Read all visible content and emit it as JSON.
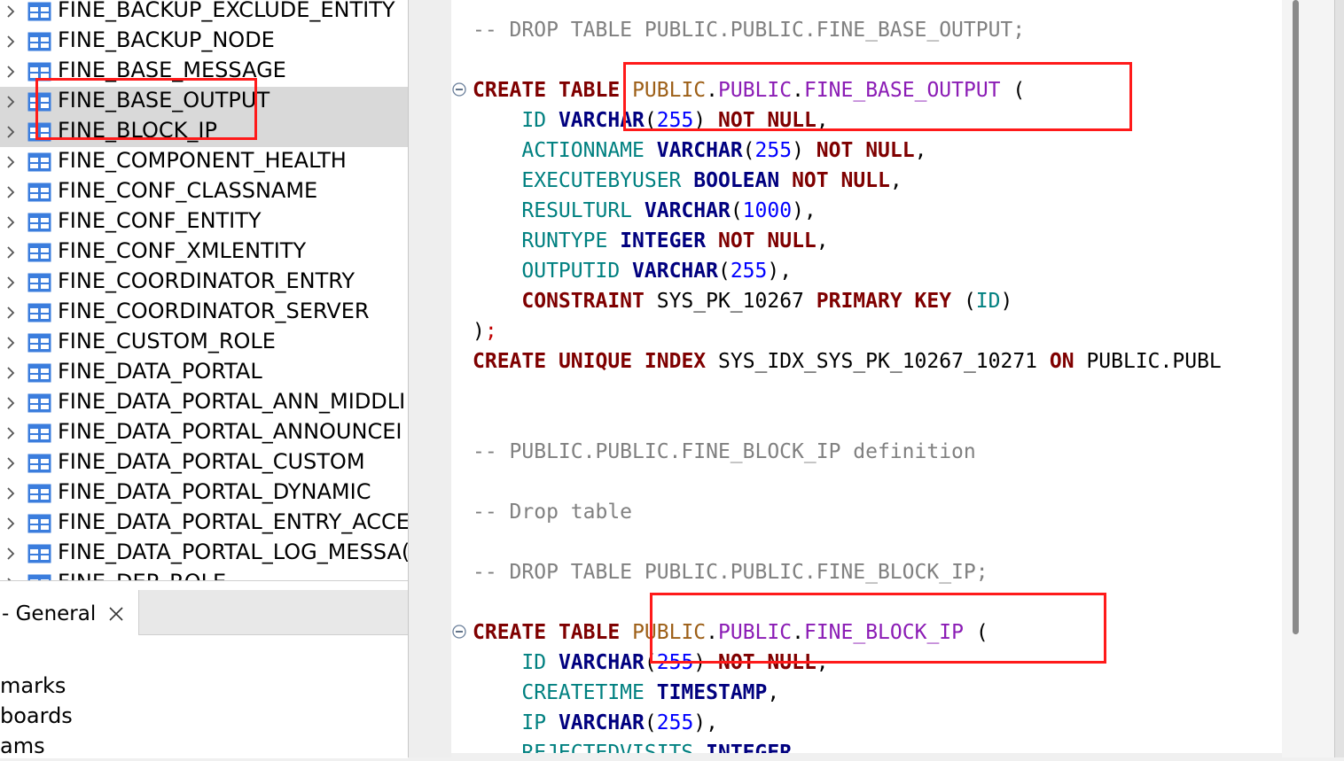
{
  "navigator": {
    "items": [
      {
        "label": "FINE_BACKUP_EXCLUDE_ENTITY",
        "selected": false
      },
      {
        "label": "FINE_BACKUP_NODE",
        "selected": false
      },
      {
        "label": "FINE_BASE_MESSAGE",
        "selected": false
      },
      {
        "label": "FINE_BASE_OUTPUT",
        "selected": true
      },
      {
        "label": "FINE_BLOCK_IP",
        "selected": true
      },
      {
        "label": "FINE_COMPONENT_HEALTH",
        "selected": false
      },
      {
        "label": "FINE_CONF_CLASSNAME",
        "selected": false
      },
      {
        "label": "FINE_CONF_ENTITY",
        "selected": false
      },
      {
        "label": "FINE_CONF_XMLENTITY",
        "selected": false
      },
      {
        "label": "FINE_COORDINATOR_ENTRY",
        "selected": false
      },
      {
        "label": "FINE_COORDINATOR_SERVER",
        "selected": false
      },
      {
        "label": "FINE_CUSTOM_ROLE",
        "selected": false
      },
      {
        "label": "FINE_DATA_PORTAL",
        "selected": false
      },
      {
        "label": "FINE_DATA_PORTAL_ANN_MIDDLI",
        "selected": false
      },
      {
        "label": "FINE_DATA_PORTAL_ANNOUNCEI",
        "selected": false
      },
      {
        "label": "FINE_DATA_PORTAL_CUSTOM",
        "selected": false
      },
      {
        "label": "FINE_DATA_PORTAL_DYNAMIC",
        "selected": false
      },
      {
        "label": "FINE_DATA_PORTAL_ENTRY_ACCE",
        "selected": false
      },
      {
        "label": "FINE_DATA_PORTAL_LOG_MESSA(",
        "selected": false
      },
      {
        "label": "FINE_DEP_ROLE",
        "selected": false
      }
    ],
    "item_icon": "table-icon",
    "expander_icon": "chevron-right-icon"
  },
  "bottom_panel": {
    "tab_label": "- General",
    "tab_close_icon": "close-icon",
    "items": [
      "marks",
      "boards",
      "ams"
    ]
  },
  "editor": {
    "lines": [
      {
        "tokens": [
          {
            "t": "-- DROP TABLE PUBLIC.PUBLIC.FINE_BASE_OUTPUT;",
            "c": "cm"
          }
        ]
      },
      {
        "tokens": []
      },
      {
        "fold": true,
        "tokens": [
          {
            "t": "CREATE",
            "c": "kw"
          },
          {
            "t": " ",
            "c": "pl"
          },
          {
            "t": "TABLE",
            "c": "kw"
          },
          {
            "t": " ",
            "c": "pl"
          },
          {
            "t": "PUBLIC",
            "c": "sch"
          },
          {
            "t": ".",
            "c": "punc"
          },
          {
            "t": "PUBLIC",
            "c": "tn"
          },
          {
            "t": ".",
            "c": "punc"
          },
          {
            "t": "FINE_BASE_OUTPUT",
            "c": "tn"
          },
          {
            "t": " (",
            "c": "punc"
          }
        ]
      },
      {
        "tokens": [
          {
            "t": "    ",
            "c": "pl"
          },
          {
            "t": "ID",
            "c": "col"
          },
          {
            "t": " ",
            "c": "pl"
          },
          {
            "t": "VARCHAR",
            "c": "ty"
          },
          {
            "t": "(",
            "c": "punc"
          },
          {
            "t": "255",
            "c": "num"
          },
          {
            "t": ") ",
            "c": "punc"
          },
          {
            "t": "NOT",
            "c": "kw"
          },
          {
            "t": " ",
            "c": "pl"
          },
          {
            "t": "NULL",
            "c": "kw"
          },
          {
            "t": ",",
            "c": "punc"
          }
        ]
      },
      {
        "tokens": [
          {
            "t": "    ",
            "c": "pl"
          },
          {
            "t": "ACTIONNAME",
            "c": "col"
          },
          {
            "t": " ",
            "c": "pl"
          },
          {
            "t": "VARCHAR",
            "c": "ty"
          },
          {
            "t": "(",
            "c": "punc"
          },
          {
            "t": "255",
            "c": "num"
          },
          {
            "t": ") ",
            "c": "punc"
          },
          {
            "t": "NOT",
            "c": "kw"
          },
          {
            "t": " ",
            "c": "pl"
          },
          {
            "t": "NULL",
            "c": "kw"
          },
          {
            "t": ",",
            "c": "punc"
          }
        ]
      },
      {
        "tokens": [
          {
            "t": "    ",
            "c": "pl"
          },
          {
            "t": "EXECUTEBYUSER",
            "c": "col"
          },
          {
            "t": " ",
            "c": "pl"
          },
          {
            "t": "BOOLEAN",
            "c": "ty"
          },
          {
            "t": " ",
            "c": "pl"
          },
          {
            "t": "NOT",
            "c": "kw"
          },
          {
            "t": " ",
            "c": "pl"
          },
          {
            "t": "NULL",
            "c": "kw"
          },
          {
            "t": ",",
            "c": "punc"
          }
        ]
      },
      {
        "tokens": [
          {
            "t": "    ",
            "c": "pl"
          },
          {
            "t": "RESULTURL",
            "c": "col"
          },
          {
            "t": " ",
            "c": "pl"
          },
          {
            "t": "VARCHAR",
            "c": "ty"
          },
          {
            "t": "(",
            "c": "punc"
          },
          {
            "t": "1000",
            "c": "num"
          },
          {
            "t": "),",
            "c": "punc"
          }
        ]
      },
      {
        "tokens": [
          {
            "t": "    ",
            "c": "pl"
          },
          {
            "t": "RUNTYPE",
            "c": "col"
          },
          {
            "t": " ",
            "c": "pl"
          },
          {
            "t": "INTEGER",
            "c": "ty"
          },
          {
            "t": " ",
            "c": "pl"
          },
          {
            "t": "NOT",
            "c": "kw"
          },
          {
            "t": " ",
            "c": "pl"
          },
          {
            "t": "NULL",
            "c": "kw"
          },
          {
            "t": ",",
            "c": "punc"
          }
        ]
      },
      {
        "tokens": [
          {
            "t": "    ",
            "c": "pl"
          },
          {
            "t": "OUTPUTID",
            "c": "col"
          },
          {
            "t": " ",
            "c": "pl"
          },
          {
            "t": "VARCHAR",
            "c": "ty"
          },
          {
            "t": "(",
            "c": "punc"
          },
          {
            "t": "255",
            "c": "num"
          },
          {
            "t": "),",
            "c": "punc"
          }
        ]
      },
      {
        "tokens": [
          {
            "t": "    ",
            "c": "pl"
          },
          {
            "t": "CONSTRAINT",
            "c": "kw"
          },
          {
            "t": " SYS_PK_10267 ",
            "c": "pl"
          },
          {
            "t": "PRIMARY",
            "c": "kw"
          },
          {
            "t": " ",
            "c": "pl"
          },
          {
            "t": "KEY",
            "c": "kw"
          },
          {
            "t": " (",
            "c": "punc"
          },
          {
            "t": "ID",
            "c": "col"
          },
          {
            "t": ")",
            "c": "punc"
          }
        ]
      },
      {
        "tokens": [
          {
            "t": ")",
            "c": "punc"
          },
          {
            "t": ";",
            "c": "semi"
          }
        ]
      },
      {
        "tokens": [
          {
            "t": "CREATE",
            "c": "kw"
          },
          {
            "t": " ",
            "c": "pl"
          },
          {
            "t": "UNIQUE",
            "c": "kw"
          },
          {
            "t": " ",
            "c": "pl"
          },
          {
            "t": "INDEX",
            "c": "kw"
          },
          {
            "t": " SYS_IDX_SYS_PK_10267_10271 ",
            "c": "pl"
          },
          {
            "t": "ON",
            "c": "kw"
          },
          {
            "t": " PUBLIC.PUBL",
            "c": "pl"
          }
        ]
      },
      {
        "tokens": []
      },
      {
        "tokens": []
      },
      {
        "tokens": [
          {
            "t": "-- PUBLIC.PUBLIC.FINE_BLOCK_IP definition",
            "c": "cm"
          }
        ]
      },
      {
        "tokens": []
      },
      {
        "tokens": [
          {
            "t": "-- Drop table",
            "c": "cm"
          }
        ]
      },
      {
        "tokens": []
      },
      {
        "tokens": [
          {
            "t": "-- DROP TABLE PUBLIC.PUBLIC.FINE_BLOCK_IP;",
            "c": "cm"
          }
        ]
      },
      {
        "tokens": []
      },
      {
        "fold": true,
        "tokens": [
          {
            "t": "CREATE",
            "c": "kw"
          },
          {
            "t": " ",
            "c": "pl"
          },
          {
            "t": "TABLE",
            "c": "kw"
          },
          {
            "t": " ",
            "c": "pl"
          },
          {
            "t": "PUBLIC",
            "c": "sch"
          },
          {
            "t": ".",
            "c": "punc"
          },
          {
            "t": "PUBLIC",
            "c": "tn"
          },
          {
            "t": ".",
            "c": "punc"
          },
          {
            "t": "FINE_BLOCK_IP",
            "c": "tn"
          },
          {
            "t": " (",
            "c": "punc"
          }
        ]
      },
      {
        "tokens": [
          {
            "t": "    ",
            "c": "pl"
          },
          {
            "t": "ID",
            "c": "col"
          },
          {
            "t": " ",
            "c": "pl"
          },
          {
            "t": "VARCHAR",
            "c": "ty"
          },
          {
            "t": "(",
            "c": "punc"
          },
          {
            "t": "255",
            "c": "num"
          },
          {
            "t": ") ",
            "c": "punc"
          },
          {
            "t": "NOT",
            "c": "kw"
          },
          {
            "t": " ",
            "c": "pl"
          },
          {
            "t": "NULL",
            "c": "kw"
          },
          {
            "t": ",",
            "c": "punc"
          }
        ]
      },
      {
        "tokens": [
          {
            "t": "    ",
            "c": "pl"
          },
          {
            "t": "CREATETIME",
            "c": "col"
          },
          {
            "t": " ",
            "c": "pl"
          },
          {
            "t": "TIMESTAMP",
            "c": "ty"
          },
          {
            "t": ",",
            "c": "punc"
          }
        ]
      },
      {
        "tokens": [
          {
            "t": "    ",
            "c": "pl"
          },
          {
            "t": "IP",
            "c": "col"
          },
          {
            "t": " ",
            "c": "pl"
          },
          {
            "t": "VARCHAR",
            "c": "ty"
          },
          {
            "t": "(",
            "c": "punc"
          },
          {
            "t": "255",
            "c": "num"
          },
          {
            "t": "),",
            "c": "punc"
          }
        ]
      },
      {
        "tokens": [
          {
            "t": "    ",
            "c": "pl"
          },
          {
            "t": "REJECTEDVISITS",
            "c": "col"
          },
          {
            "t": " ",
            "c": "pl"
          },
          {
            "t": "INTEGER",
            "c": "ty"
          },
          {
            "t": ",",
            "c": "punc"
          }
        ]
      }
    ],
    "fold_icon": "collapse-minus-icon"
  },
  "colors": {
    "keyword": "#7f0000",
    "type": "#00007f",
    "number": "#0000ff",
    "column": "#008080",
    "schema": "#9d5f17",
    "table_name": "#8b1cb5",
    "comment": "#808080",
    "highlight_box": "#ff1a1a",
    "selection": "#d9d9d9",
    "table_icon": "#3b7ddd"
  }
}
